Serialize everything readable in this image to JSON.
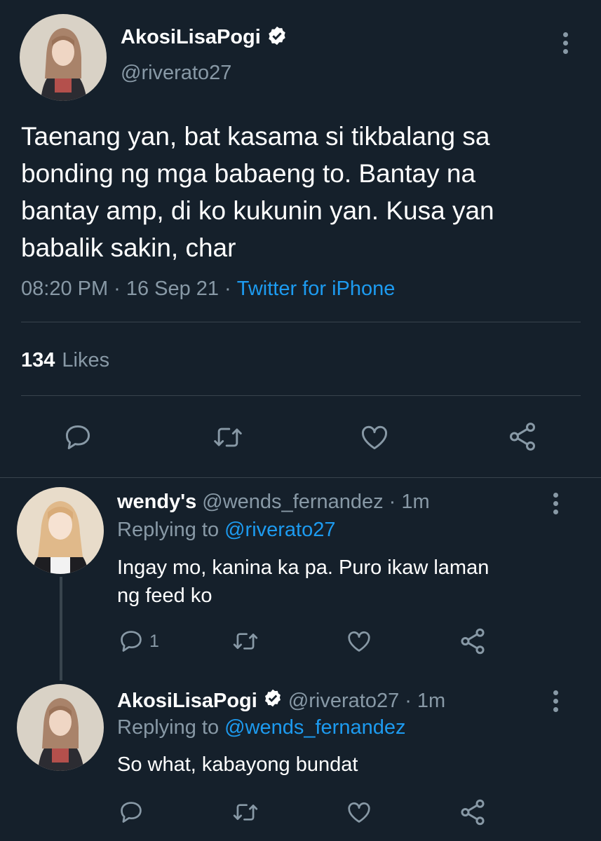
{
  "main_tweet": {
    "display_name": "AkosiLisaPogi",
    "handle": "@riverato27",
    "text_lines": [
      "Taenang yan, bat kasama si tikbalang sa",
      "bonding ng mga babaeng to. Bantay na",
      "bantay amp, di ko kukunin yan. Kusa yan",
      "babalik sakin, char"
    ],
    "time": "08:20 PM",
    "date": "16 Sep 21",
    "source": "Twitter for iPhone",
    "likes_count": "134",
    "likes_label": "Likes"
  },
  "replies": [
    {
      "display_name": "wendy's",
      "handle": "@wends_fernandez",
      "time": "1m",
      "replying_label": "Replying to",
      "replying_to": "@riverato27",
      "text_lines": [
        "Ingay mo, kanina ka pa. Puro ikaw laman",
        "ng feed ko"
      ],
      "reply_count": "1"
    },
    {
      "display_name": "AkosiLisaPogi",
      "handle": "@riverato27",
      "time": "1m",
      "replying_label": "Replying to",
      "replying_to": "@wends_fernandez",
      "text_lines": [
        "So what, kabayong bundat"
      ],
      "reply_count": ""
    }
  ],
  "separator": "·",
  "icons": {
    "verified": "verified-badge-icon",
    "more": "more-options-icon",
    "reply": "reply-icon",
    "retweet": "retweet-icon",
    "like": "heart-icon",
    "share": "share-icon"
  },
  "colors": {
    "background": "#15202b",
    "accent": "#1d9bf0",
    "muted": "#8899a6",
    "divider": "#38444d"
  }
}
